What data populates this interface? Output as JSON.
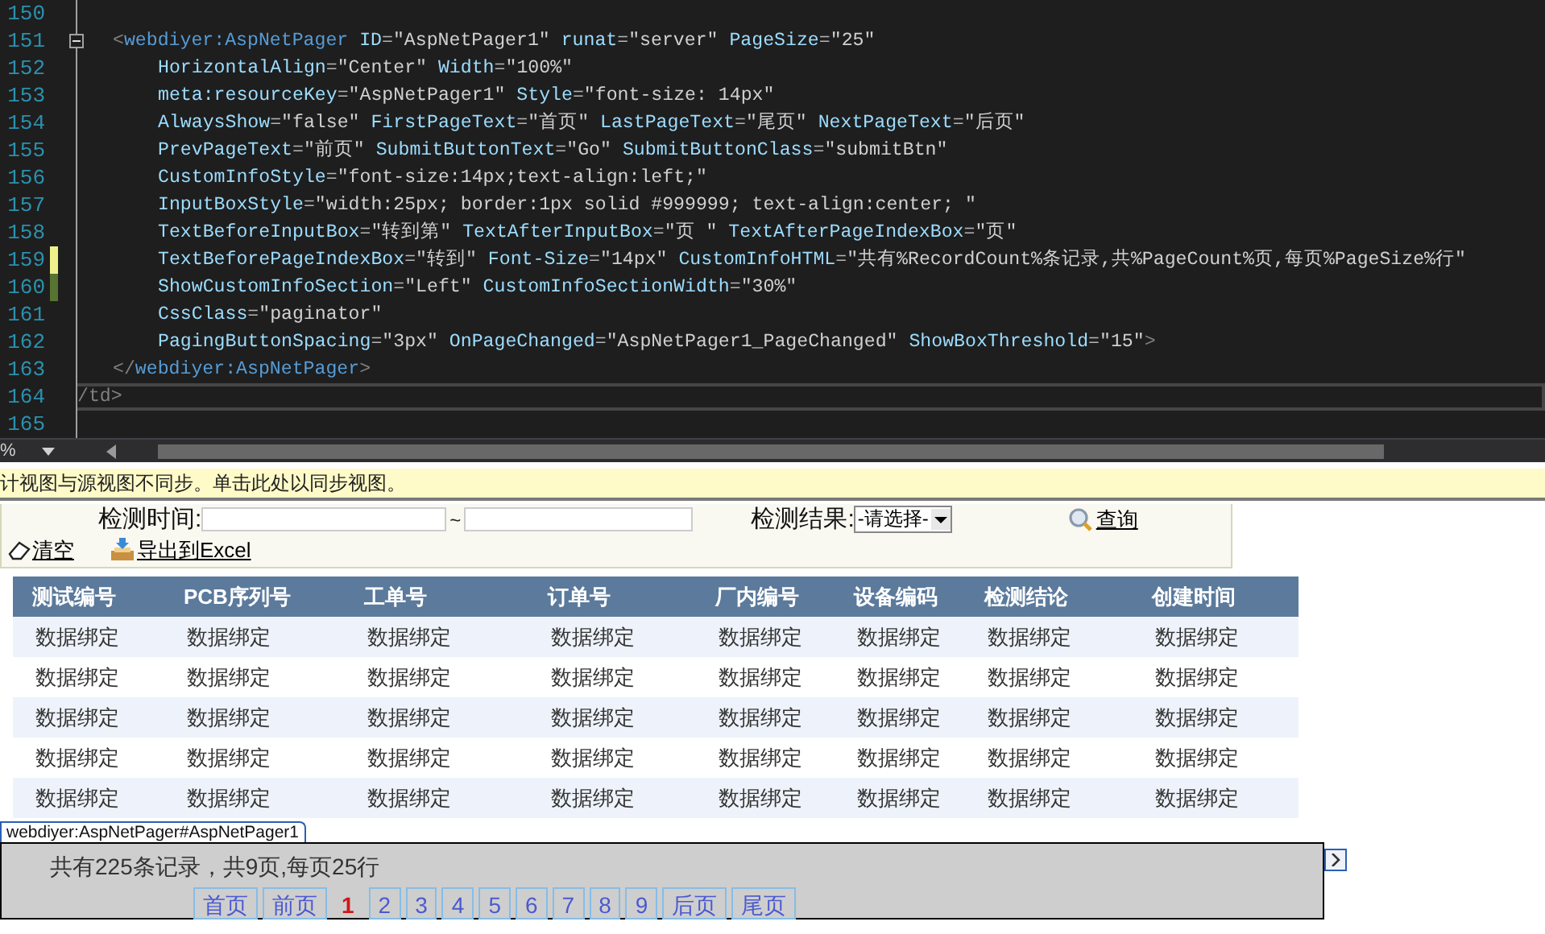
{
  "editor": {
    "lines": [
      {
        "number": "150",
        "collapsible": false,
        "current": false
      },
      {
        "number": "151",
        "kind": "tag",
        "collapsible": true,
        "current": false,
        "tokens": [
          {
            "kind": "bracket",
            "text": "<"
          },
          {
            "kind": "tag",
            "text": "webdiyer:AspNetPager"
          },
          {
            "kind": "attr",
            "text": " ID"
          },
          {
            "kind": "eq",
            "text": "="
          },
          {
            "kind": "value",
            "text": "\"AspNetPager1\""
          },
          {
            "kind": "attr",
            "text": " runat"
          },
          {
            "kind": "eq",
            "text": "="
          },
          {
            "kind": "value",
            "text": "\"server\""
          },
          {
            "kind": "attr",
            "text": " PageSize"
          },
          {
            "kind": "eq",
            "text": "="
          },
          {
            "kind": "value",
            "text": "\"25\""
          }
        ]
      },
      {
        "number": "152",
        "kind": "attr",
        "collapsible": false,
        "current": false,
        "tokens": [
          {
            "kind": "attr",
            "text": "HorizontalAlign"
          },
          {
            "kind": "eq",
            "text": "="
          },
          {
            "kind": "value",
            "text": "\"Center\""
          },
          {
            "kind": "attr",
            "text": " Width"
          },
          {
            "kind": "eq",
            "text": "="
          },
          {
            "kind": "value",
            "text": "\"100%\""
          }
        ]
      },
      {
        "number": "153",
        "kind": "attr",
        "collapsible": false,
        "current": false,
        "tokens": [
          {
            "kind": "attr",
            "text": "meta:resourceKey"
          },
          {
            "kind": "eq",
            "text": "="
          },
          {
            "kind": "value",
            "text": "\"AspNetPager1\""
          },
          {
            "kind": "attr",
            "text": " Style"
          },
          {
            "kind": "eq",
            "text": "="
          },
          {
            "kind": "value",
            "text": "\"font-size: 14px\""
          }
        ]
      },
      {
        "number": "154",
        "kind": "attr",
        "collapsible": false,
        "current": false,
        "tokens": [
          {
            "kind": "attr",
            "text": "AlwaysShow"
          },
          {
            "kind": "eq",
            "text": "="
          },
          {
            "kind": "value",
            "text": "\"false\""
          },
          {
            "kind": "attr",
            "text": " FirstPageText"
          },
          {
            "kind": "eq",
            "text": "="
          },
          {
            "kind": "value",
            "text": "\"首页\""
          },
          {
            "kind": "attr",
            "text": " LastPageText"
          },
          {
            "kind": "eq",
            "text": "="
          },
          {
            "kind": "value",
            "text": "\"尾页\""
          },
          {
            "kind": "attr",
            "text": " NextPageText"
          },
          {
            "kind": "eq",
            "text": "="
          },
          {
            "kind": "value",
            "text": "\"后页\""
          }
        ]
      },
      {
        "number": "155",
        "kind": "attr",
        "collapsible": false,
        "current": false,
        "tokens": [
          {
            "kind": "attr",
            "text": "PrevPageText"
          },
          {
            "kind": "eq",
            "text": "="
          },
          {
            "kind": "value",
            "text": "\"前页\""
          },
          {
            "kind": "attr",
            "text": " SubmitButtonText"
          },
          {
            "kind": "eq",
            "text": "="
          },
          {
            "kind": "value",
            "text": "\"Go\""
          },
          {
            "kind": "attr",
            "text": " SubmitButtonClass"
          },
          {
            "kind": "eq",
            "text": "="
          },
          {
            "kind": "value",
            "text": "\"submitBtn\""
          }
        ]
      },
      {
        "number": "156",
        "kind": "attr",
        "collapsible": false,
        "current": false,
        "tokens": [
          {
            "kind": "attr",
            "text": "CustomInfoStyle"
          },
          {
            "kind": "eq",
            "text": "="
          },
          {
            "kind": "value",
            "text": "\"font-size:14px;text-align:left;\""
          }
        ]
      },
      {
        "number": "157",
        "kind": "attr",
        "collapsible": false,
        "current": false,
        "tokens": [
          {
            "kind": "attr",
            "text": "InputBoxStyle"
          },
          {
            "kind": "eq",
            "text": "="
          },
          {
            "kind": "value",
            "text": "\"width:25px; border:1px solid #999999; text-align:center; \""
          }
        ]
      },
      {
        "number": "158",
        "kind": "attr",
        "collapsible": false,
        "current": false,
        "tokens": [
          {
            "kind": "attr",
            "text": "TextBeforeInputBox"
          },
          {
            "kind": "eq",
            "text": "="
          },
          {
            "kind": "value",
            "text": "\"转到第\""
          },
          {
            "kind": "attr",
            "text": " TextAfterInputBox"
          },
          {
            "kind": "eq",
            "text": "="
          },
          {
            "kind": "value",
            "text": "\"页 \""
          },
          {
            "kind": "attr",
            "text": " TextAfterPageIndexBox"
          },
          {
            "kind": "eq",
            "text": "="
          },
          {
            "kind": "value",
            "text": "\"页\""
          }
        ]
      },
      {
        "number": "159",
        "kind": "attr",
        "color": "#efef8c",
        "collapsible": false,
        "current": false,
        "tokens": [
          {
            "kind": "attr",
            "text": "TextBeforePageIndexBox"
          },
          {
            "kind": "eq",
            "text": "="
          },
          {
            "kind": "value",
            "text": "\"转到\""
          },
          {
            "kind": "attr",
            "text": " Font-Size"
          },
          {
            "kind": "eq",
            "text": "="
          },
          {
            "kind": "value",
            "text": "\"14px\""
          },
          {
            "kind": "attr",
            "text": " CustomInfoHTML"
          },
          {
            "kind": "eq",
            "text": "="
          },
          {
            "kind": "value",
            "text": "\"共有%RecordCount%条记录,共%PageCount%页,每页%PageSize%行\""
          }
        ]
      },
      {
        "number": "160",
        "kind": "attr",
        "color": "#577430",
        "collapsible": false,
        "current": false,
        "tokens": [
          {
            "kind": "attr",
            "text": "ShowCustomInfoSection"
          },
          {
            "kind": "eq",
            "text": "="
          },
          {
            "kind": "value",
            "text": "\"Left\""
          },
          {
            "kind": "attr",
            "text": " CustomInfoSectionWidth"
          },
          {
            "kind": "eq",
            "text": "="
          },
          {
            "kind": "value",
            "text": "\"30%\""
          }
        ]
      },
      {
        "number": "161",
        "kind": "attr",
        "collapsible": false,
        "current": false,
        "tokens": [
          {
            "kind": "attr",
            "text": "CssClass"
          },
          {
            "kind": "eq",
            "text": "="
          },
          {
            "kind": "value",
            "text": "\"paginator\""
          }
        ]
      },
      {
        "number": "162",
        "kind": "attr",
        "collapsible": false,
        "current": false,
        "tokens": [
          {
            "kind": "attr",
            "text": "PagingButtonSpacing"
          },
          {
            "kind": "eq",
            "text": "="
          },
          {
            "kind": "value",
            "text": "\"3px\""
          },
          {
            "kind": "attr",
            "text": " OnPageChanged"
          },
          {
            "kind": "eq",
            "text": "="
          },
          {
            "kind": "value",
            "text": "\"AspNetPager1_PageChanged\""
          },
          {
            "kind": "attr",
            "text": " ShowBoxThreshold"
          },
          {
            "kind": "eq",
            "text": "="
          },
          {
            "kind": "value",
            "text": "\"15\""
          },
          {
            "kind": "bracket",
            "text": ">"
          }
        ]
      },
      {
        "number": "163",
        "kind": "tag",
        "collapsible": false,
        "current": false,
        "tokens": [
          {
            "kind": "bracket",
            "text": "</"
          },
          {
            "kind": "tag",
            "text": "webdiyer:AspNetPager"
          },
          {
            "kind": "bracket",
            "text": ">"
          }
        ]
      },
      {
        "number": "164",
        "kind": "plain",
        "collapsible": false,
        "current": true,
        "tokens": [
          {
            "kind": "bracket",
            "text": "/td>"
          }
        ]
      },
      {
        "number": "165",
        "collapsible": false,
        "current": false
      }
    ],
    "zoom": "%"
  },
  "sync_bar": {
    "text": "计视图与源视图不同步。单击此处以同步视图。"
  },
  "search": {
    "time_label": "检测时间:",
    "range_separator": "~",
    "result_label": "检测结果:",
    "result_select": {
      "value": "-请选择-"
    },
    "query_link": "查询",
    "clear_link": "清空",
    "export_link": "导出到Excel"
  },
  "table": {
    "columns": [
      "测试编号",
      "PCB序列号",
      "工单号",
      "订单号",
      "厂内编号",
      "设备编码",
      "检测结论",
      "创建时间"
    ],
    "rows": [
      [
        "数据绑定",
        "数据绑定",
        "数据绑定",
        "数据绑定",
        "数据绑定",
        "数据绑定",
        "数据绑定",
        "数据绑定"
      ],
      [
        "数据绑定",
        "数据绑定",
        "数据绑定",
        "数据绑定",
        "数据绑定",
        "数据绑定",
        "数据绑定",
        "数据绑定"
      ],
      [
        "数据绑定",
        "数据绑定",
        "数据绑定",
        "数据绑定",
        "数据绑定",
        "数据绑定",
        "数据绑定",
        "数据绑定"
      ],
      [
        "数据绑定",
        "数据绑定",
        "数据绑定",
        "数据绑定",
        "数据绑定",
        "数据绑定",
        "数据绑定",
        "数据绑定"
      ],
      [
        "数据绑定",
        "数据绑定",
        "数据绑定",
        "数据绑定",
        "数据绑定",
        "数据绑定",
        "数据绑定",
        "数据绑定"
      ]
    ]
  },
  "pager": {
    "tag": "webdiyer:AspNetPager#AspNetPager1",
    "info": "共有225条记录，共9页,每页25行",
    "buttons": [
      {
        "label": "首页",
        "selected": false
      },
      {
        "label": "前页",
        "selected": false
      },
      {
        "label": "1",
        "selected": true
      },
      {
        "label": "2",
        "selected": false
      },
      {
        "label": "3",
        "selected": false
      },
      {
        "label": "4",
        "selected": false
      },
      {
        "label": "5",
        "selected": false
      },
      {
        "label": "6",
        "selected": false
      },
      {
        "label": "7",
        "selected": false
      },
      {
        "label": "8",
        "selected": false
      },
      {
        "label": "9",
        "selected": false
      },
      {
        "label": "后页",
        "selected": false
      },
      {
        "label": "尾页",
        "selected": false
      }
    ]
  }
}
